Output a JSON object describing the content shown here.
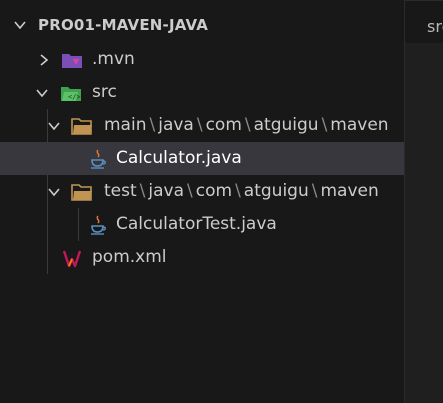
{
  "explorer": {
    "section_title": "PRO01-MAVEN-JAVA",
    "tree": {
      "mvn": ".mvn",
      "src": "src",
      "main_path": [
        "main",
        "java",
        "com",
        "atguigu",
        "maven"
      ],
      "calculator": "Calculator.java",
      "test_path": [
        "test",
        "java",
        "com",
        "atguigu",
        "maven"
      ],
      "calculator_test": "CalculatorTest.java",
      "pom": "pom.xml"
    }
  },
  "editor": {
    "tab_label": "src"
  },
  "colors": {
    "background": "#181818",
    "selection": "#37373d",
    "text": "#cccccc",
    "folder_mvn": "#7b4fb8",
    "folder_src": "#3fa34d",
    "folder_plain": "#c09553",
    "java": "#e1793a",
    "maven": "#c2185b"
  }
}
